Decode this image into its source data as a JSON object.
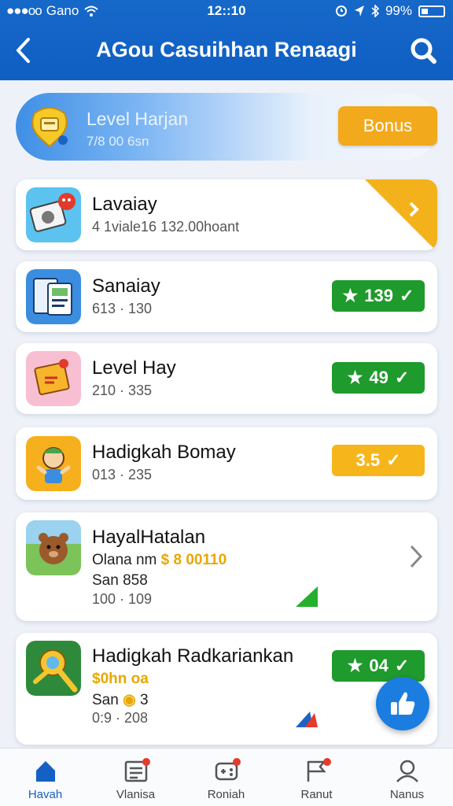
{
  "status_bar": {
    "carrier": "Gano",
    "time": "12::10",
    "battery": "99%"
  },
  "header": {
    "title": "AGou Casuihhan Renaagi"
  },
  "level_card": {
    "title": "Level Harjan",
    "subtitle": "7/8 00 6sn",
    "button": "Bonus"
  },
  "items": [
    {
      "title": "Lavaiay",
      "subtitle": "4 1viale16 132.00hoant"
    },
    {
      "title": "Sanaiay",
      "subtitle": "613 · 130",
      "badge": "139"
    },
    {
      "title": "Level Hay",
      "subtitle": "210 · 335",
      "badge": "49"
    },
    {
      "title": "Hadigkah Bomay",
      "subtitle": "013 · 235",
      "badge": "3.5"
    },
    {
      "title": "HayalHatalan",
      "line1_text": "Olana nm",
      "line1_gold": "$ 8 00110",
      "line2": "San 858",
      "subtitle": "100 · 109"
    },
    {
      "title": "Hadigkah Radkariankan",
      "line1_gold": "$0hn oa",
      "line2_prefix": "San",
      "line2_suffix": "3",
      "subtitle": "0:9 · 208",
      "badge": "04"
    }
  ],
  "bottom_nav": [
    {
      "label": "Havah",
      "icon": "home-icon"
    },
    {
      "label": "Vlanisa",
      "icon": "list-icon"
    },
    {
      "label": "Roniah",
      "icon": "gamepad-icon"
    },
    {
      "label": "Ranut",
      "icon": "flag-icon"
    },
    {
      "label": "Nanus",
      "icon": "profile-icon"
    }
  ],
  "colors": {
    "primary": "#1668c9",
    "accent_orange": "#f2a91b",
    "green": "#1f9a2c",
    "yellow": "#f6b61b"
  }
}
